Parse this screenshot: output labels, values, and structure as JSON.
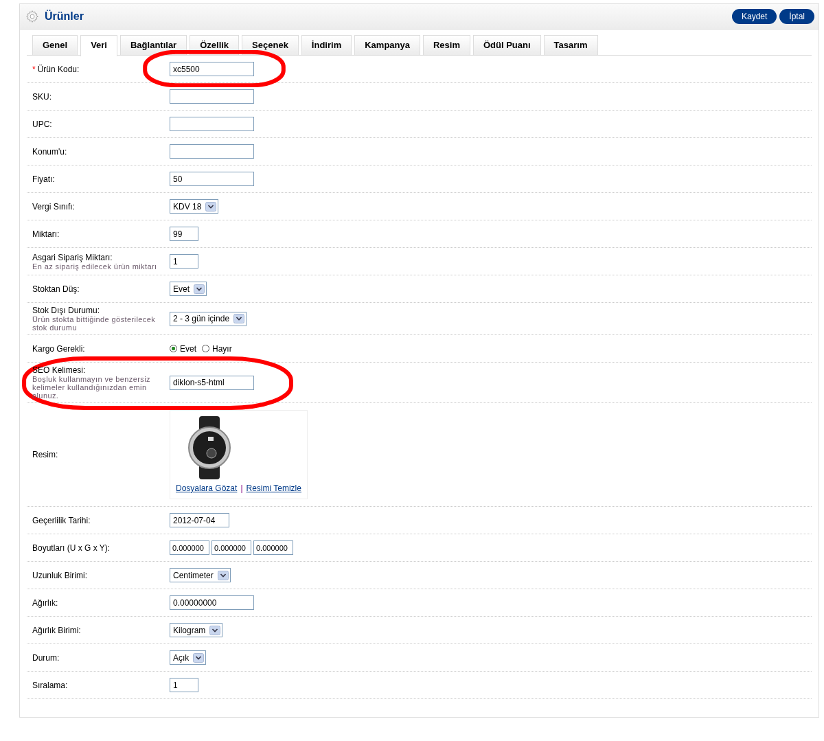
{
  "header": {
    "title": "Ürünler",
    "buttons": [
      "Kaydet",
      "İptal"
    ]
  },
  "tabs": [
    {
      "label": "Genel",
      "selected": false
    },
    {
      "label": "Veri",
      "selected": true
    },
    {
      "label": "Bağlantılar",
      "selected": false
    },
    {
      "label": "Özellik",
      "selected": false
    },
    {
      "label": "Seçenek",
      "selected": false
    },
    {
      "label": "İndirim",
      "selected": false
    },
    {
      "label": "Kampanya",
      "selected": false
    },
    {
      "label": "Resim",
      "selected": false
    },
    {
      "label": "Ödül Puanı",
      "selected": false
    },
    {
      "label": "Tasarım",
      "selected": false
    }
  ],
  "fields": [
    {
      "kind": "text",
      "label": "Ürün Kodu:",
      "required_mark": "*",
      "value": "xc5500",
      "circled": true
    },
    {
      "kind": "text",
      "label": "SKU:",
      "circled": false
    },
    {
      "kind": "text",
      "label": "UPC:",
      "circled": false
    },
    {
      "kind": "text",
      "label": "Konum'u:",
      "circled": false
    },
    {
      "kind": "text",
      "label": "Fiyatı:",
      "value": "50",
      "circled": false
    },
    {
      "kind": "select",
      "label": "Vergi Sınıfı:",
      "value": "KDV 18",
      "circled": false
    },
    {
      "kind": "short",
      "label": "Miktarı:",
      "value": "99",
      "circled": false
    },
    {
      "kind": "short",
      "label": "Asgari Sipariş Miktarı:",
      "help": "En az sipariş edilecek ürün miktarı",
      "value": "1",
      "circled": false
    },
    {
      "kind": "select",
      "label": "Stoktan Düş:",
      "value": "Evet",
      "circled": false
    },
    {
      "kind": "select",
      "label": "Stok Dışı Durumu:",
      "help": "Ürün stokta bittiğinde gösterilecek stok durumu",
      "value": "2 - 3 gün içinde",
      "circled": false
    },
    {
      "kind": "radio",
      "label": "Kargo Gerekli:",
      "circled": false,
      "options": [
        {
          "label": "Evet",
          "selected": true
        },
        {
          "label": "Hayır",
          "selected": false
        }
      ]
    },
    {
      "kind": "text",
      "label": "SEO Kelimesi:",
      "help": "Boşluk kullanmayın ve benzersiz kelimeler kullandığınızdan emin olunuz.",
      "value": "diklon-s5-html",
      "circled": true
    },
    {
      "kind": "image",
      "label": "Resim:",
      "circled": false,
      "links": [
        "Dosyalara Gözat",
        "Resimi Temizle"
      ],
      "separator": "|"
    },
    {
      "kind": "date",
      "label": "Geçerlilik Tarihi:",
      "value": "2012-07-04",
      "circled": false
    },
    {
      "kind": "dims",
      "label": "Boyutları (U x G x Y):",
      "circled": false,
      "values": [
        "0.000000",
        "0.000000",
        "0.000000"
      ]
    },
    {
      "kind": "select",
      "label": "Uzunluk Birimi:",
      "value": "Centimeter",
      "circled": false
    },
    {
      "kind": "text",
      "label": "Ağırlık:",
      "value": "0.00000000",
      "circled": false
    },
    {
      "kind": "select",
      "label": "Ağırlık Birimi:",
      "value": "Kilogram",
      "circled": false
    },
    {
      "kind": "select",
      "label": "Durum:",
      "value": "Açık",
      "circled": false
    },
    {
      "kind": "short",
      "label": "Sıralama:",
      "value": "1",
      "circled": false
    }
  ]
}
